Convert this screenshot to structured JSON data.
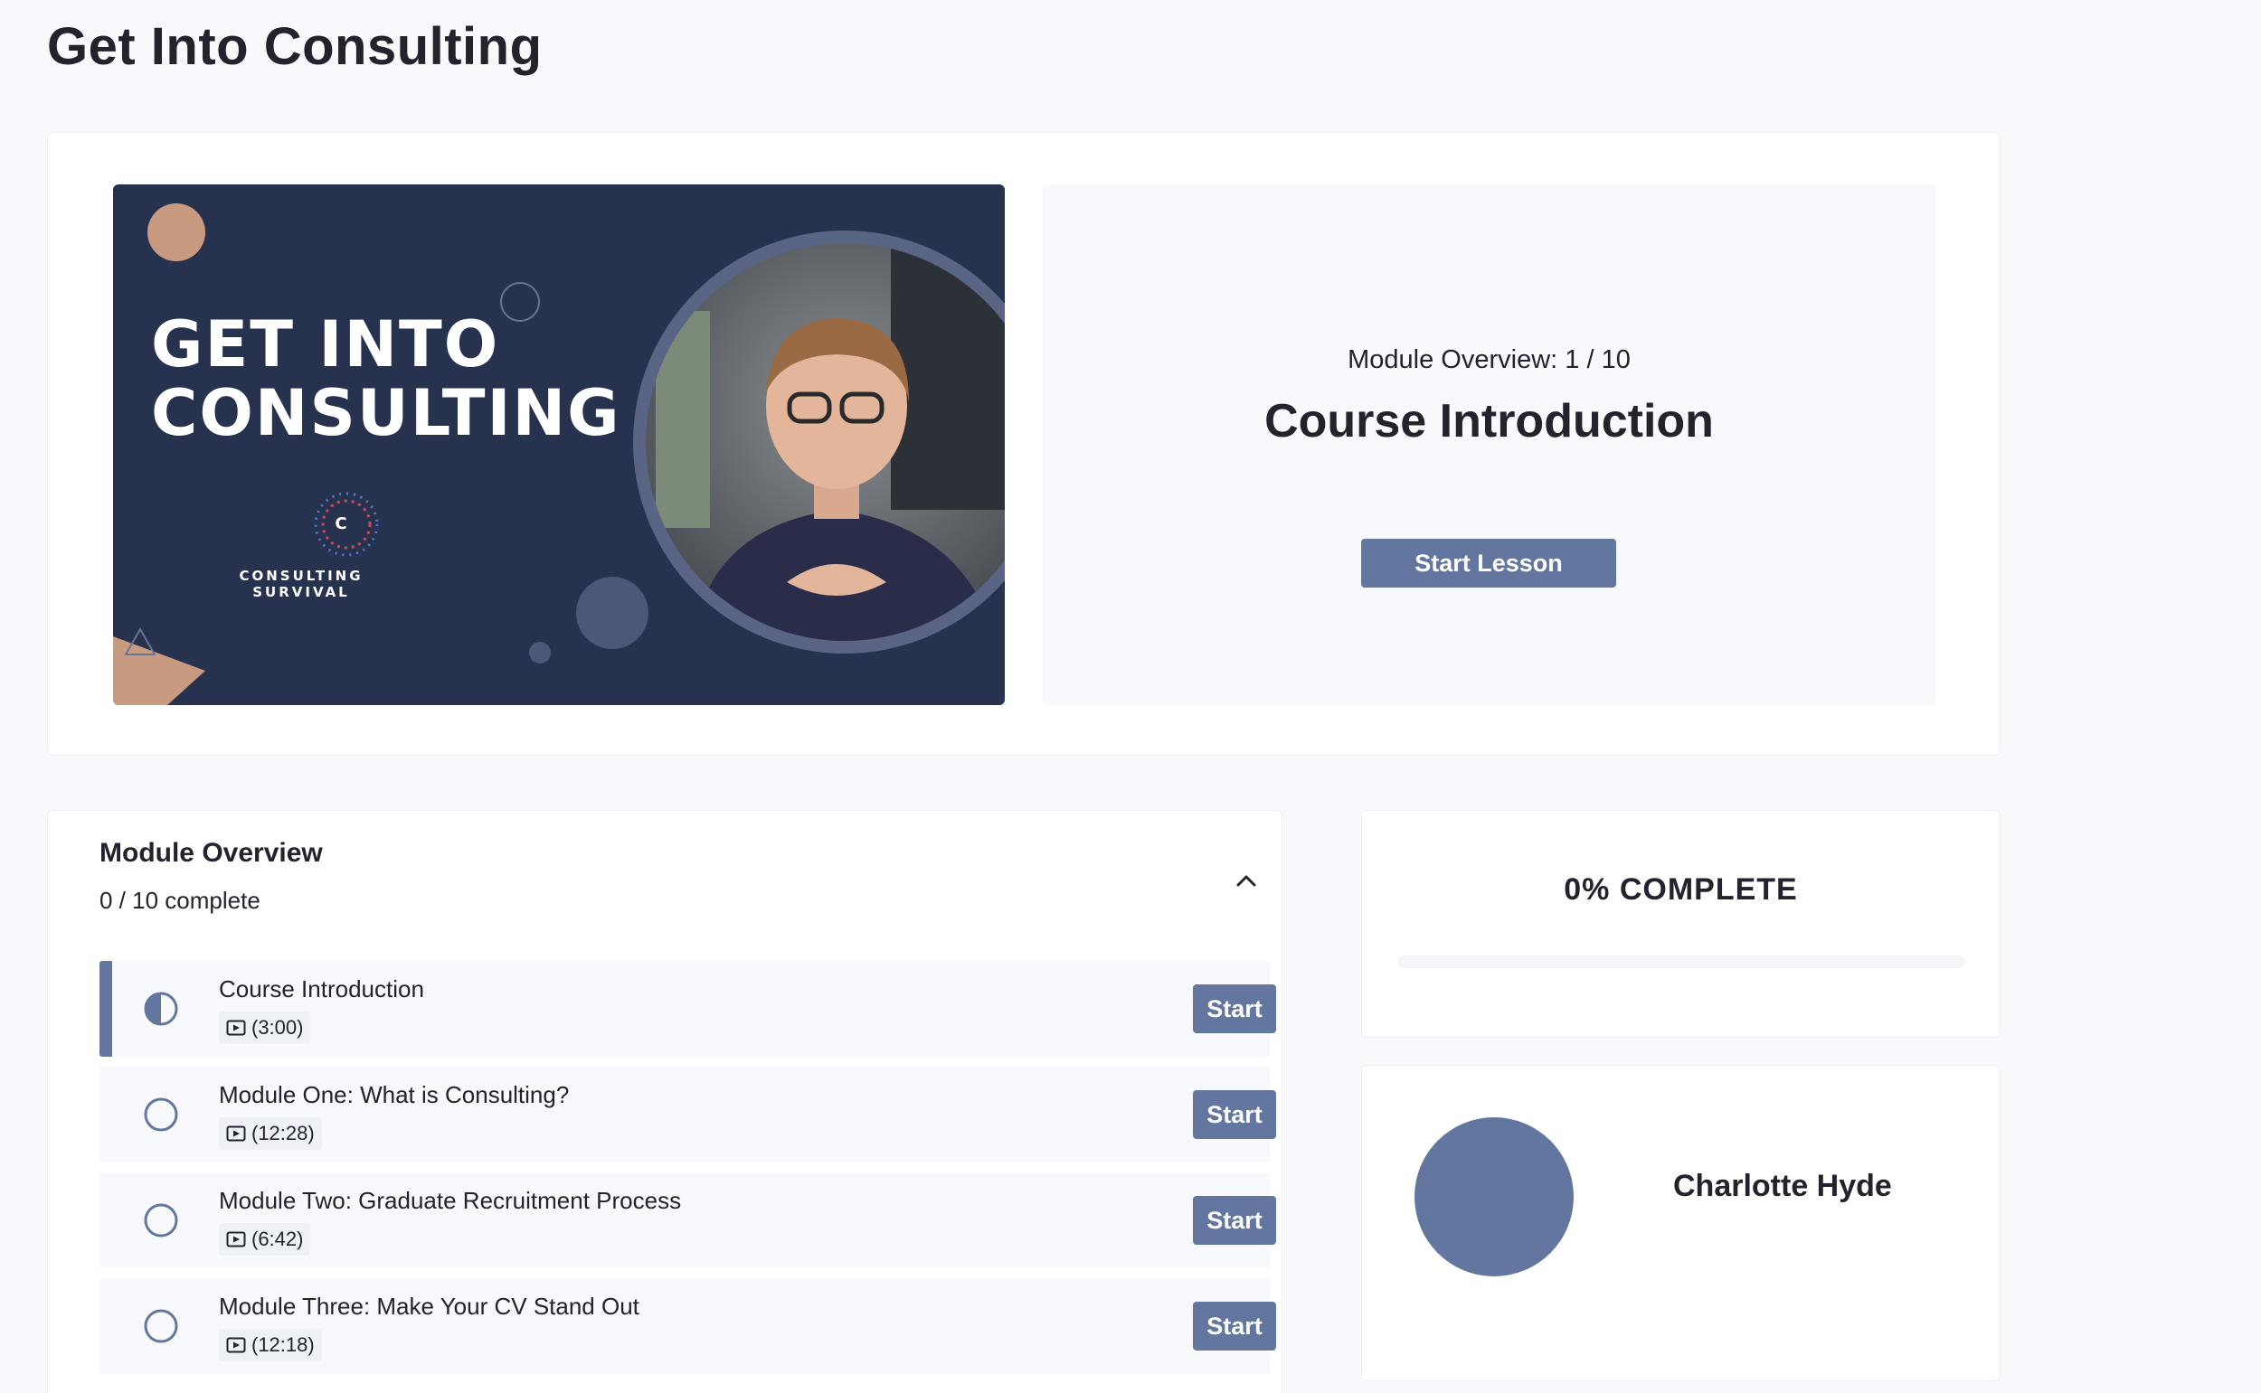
{
  "page": {
    "title": "Get Into Consulting"
  },
  "hero": {
    "video": {
      "title_line1": "GET INTO",
      "title_line2": "CONSULTING",
      "brand_letter": "C",
      "brand_name": "CONSULTING SURVIVAL"
    },
    "lesson_panel": {
      "subtitle": "Module Overview: 1 / 10",
      "title": "Course Introduction",
      "start_label": "Start Lesson"
    }
  },
  "modules": {
    "heading": "Module Overview",
    "count": "0 / 10 complete",
    "items": [
      {
        "title": "Course Introduction",
        "duration": "(3:00)",
        "action": "Start",
        "status": "in-progress"
      },
      {
        "title": "Module One: What is Consulting?",
        "duration": "(12:28)",
        "action": "Start",
        "status": "not-started"
      },
      {
        "title": "Module Two: Graduate Recruitment Process",
        "duration": "(6:42)",
        "action": "Start",
        "status": "not-started"
      },
      {
        "title": "Module Three: Make Your CV Stand Out",
        "duration": "(12:18)",
        "action": "Start",
        "status": "not-started"
      }
    ]
  },
  "progress": {
    "label": "0% COMPLETE",
    "percent": 0
  },
  "profile": {
    "name": "Charlotte Hyde"
  },
  "colors": {
    "accent": "#62769f",
    "background": "#f7f9fc",
    "video_bg": "#27324f",
    "peach": "#c89a80"
  },
  "icons": {
    "collapse": "chevron-up-icon",
    "in_progress": "half-circle-icon",
    "not_started": "empty-circle-icon",
    "duration": "video-icon"
  }
}
